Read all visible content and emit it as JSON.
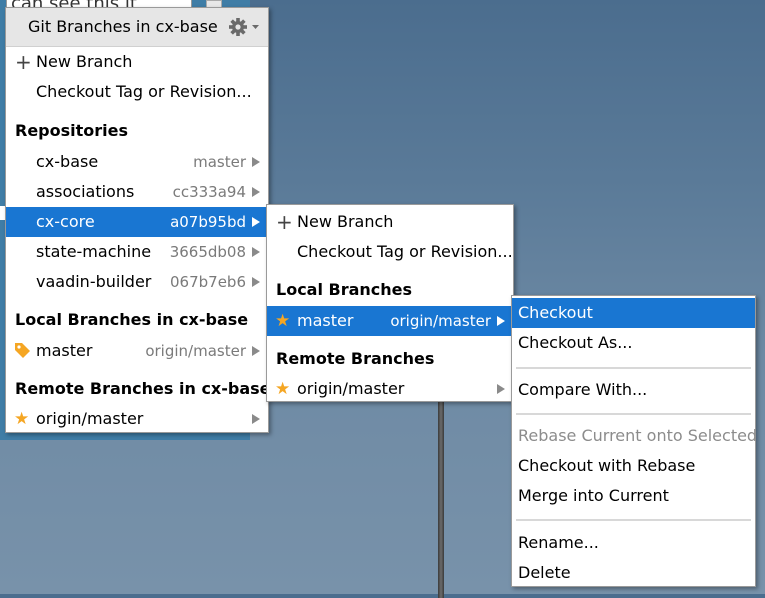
{
  "background": {
    "text_snippet": "can see this it"
  },
  "menu1": {
    "title": "Git Branches in cx-base",
    "items": {
      "new_branch": "New Branch",
      "checkout_tag": "Checkout Tag or Revision..."
    },
    "repositories_header": "Repositories",
    "repositories": [
      {
        "name": "cx-base",
        "hint": "master"
      },
      {
        "name": "associations",
        "hint": "cc333a94"
      },
      {
        "name": "cx-core",
        "hint": "a07b95bd"
      },
      {
        "name": "state-machine",
        "hint": "3665db08"
      },
      {
        "name": "vaadin-builder",
        "hint": "067b7eb6"
      }
    ],
    "local_header": "Local Branches in cx-base",
    "local_branch": {
      "name": "master",
      "hint": "origin/master"
    },
    "remote_header": "Remote Branches in cx-base",
    "remote_branch": {
      "name": "origin/master"
    }
  },
  "menu2": {
    "items": {
      "new_branch": "New Branch",
      "checkout_tag": "Checkout Tag or Revision..."
    },
    "local_header": "Local Branches",
    "local_branch": {
      "name": "master",
      "hint": "origin/master"
    },
    "remote_header": "Remote Branches",
    "remote_branch": {
      "name": "origin/master"
    }
  },
  "menu3": {
    "checkout": "Checkout",
    "checkout_as": "Checkout As...",
    "compare_with": "Compare With...",
    "rebase_current": "Rebase Current onto Selected",
    "checkout_with_rebase": "Checkout with Rebase",
    "merge_into_current": "Merge into Current",
    "rename": "Rename...",
    "delete": "Delete"
  },
  "colors": {
    "selection": "#1976d2",
    "star": "#f5a623",
    "hint": "#7a7a7a"
  }
}
